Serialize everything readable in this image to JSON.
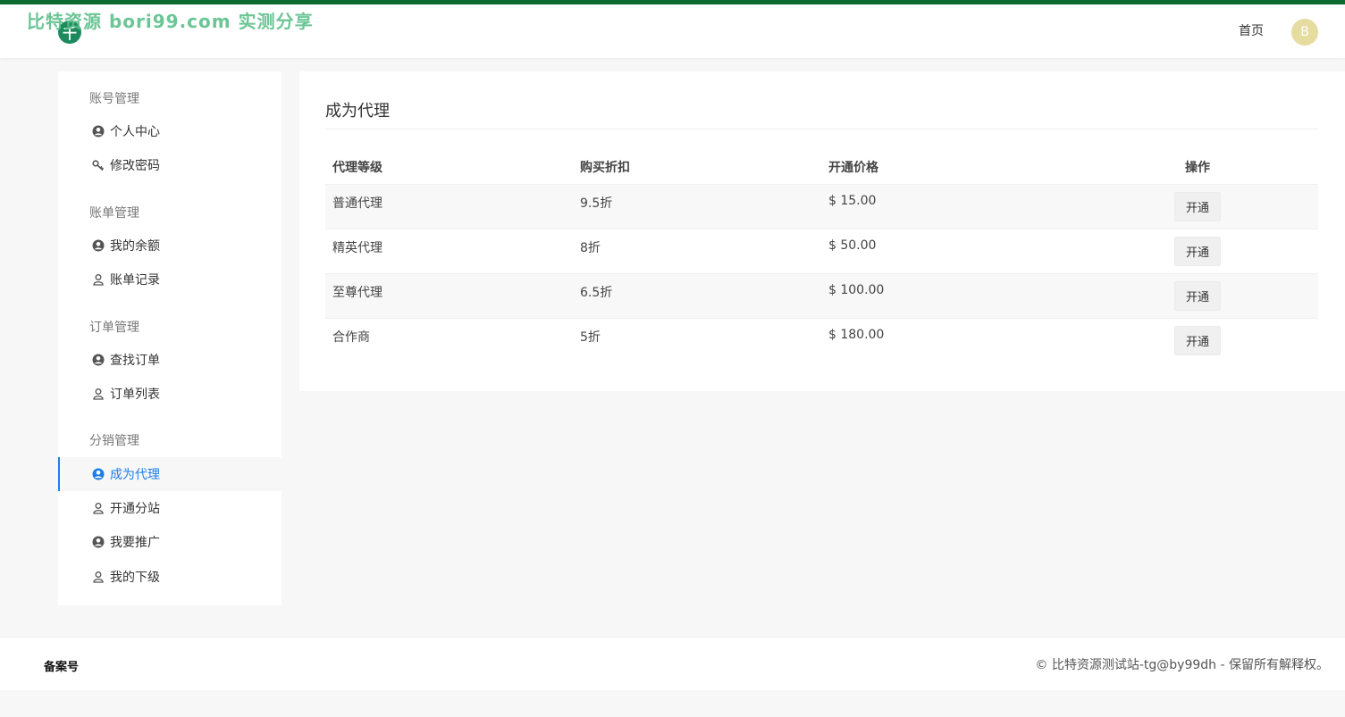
{
  "header": {
    "watermark": "比特资源 bori99.com 实测分享",
    "logo_glyph": "千",
    "nav_home": "首页",
    "avatar_letter": "B"
  },
  "sidebar": {
    "groups": [
      {
        "title": "账号管理",
        "items": [
          {
            "label": "个人中心",
            "icon": "user-solid-icon"
          },
          {
            "label": "修改密码",
            "icon": "key-icon"
          }
        ]
      },
      {
        "title": "账单管理",
        "items": [
          {
            "label": "我的余额",
            "icon": "user-solid-icon"
          },
          {
            "label": "账单记录",
            "icon": "user-outline-icon"
          }
        ]
      },
      {
        "title": "订单管理",
        "items": [
          {
            "label": "查找订单",
            "icon": "user-solid-icon"
          },
          {
            "label": "订单列表",
            "icon": "user-outline-icon"
          }
        ]
      },
      {
        "title": "分销管理",
        "items": [
          {
            "label": "成为代理",
            "icon": "user-solid-icon",
            "active": true
          },
          {
            "label": "开通分站",
            "icon": "user-outline-icon"
          },
          {
            "label": "我要推广",
            "icon": "user-solid-icon"
          },
          {
            "label": "我的下级",
            "icon": "user-outline-icon"
          }
        ]
      }
    ]
  },
  "main": {
    "title": "成为代理",
    "columns": [
      "代理等级",
      "购买折扣",
      "开通价格",
      "操作"
    ],
    "rows": [
      {
        "level": "普通代理",
        "discount": "9.5折",
        "price": "$ 15.00",
        "action": "开通"
      },
      {
        "level": "精英代理",
        "discount": "8折",
        "price": "$ 50.00",
        "action": "开通"
      },
      {
        "level": "至尊代理",
        "discount": "6.5折",
        "price": "$ 100.00",
        "action": "开通"
      },
      {
        "level": "合作商",
        "discount": "5折",
        "price": "$ 180.00",
        "action": "开通"
      }
    ]
  },
  "footer": {
    "beian": "备案号",
    "copyright": "© 比特资源测试站-tg@by99dh - 保留所有解释权。"
  },
  "colors": {
    "accent": "#1e7ee6",
    "topbar": "#0b6b2f",
    "avatar_bg": "#e6dca0"
  }
}
